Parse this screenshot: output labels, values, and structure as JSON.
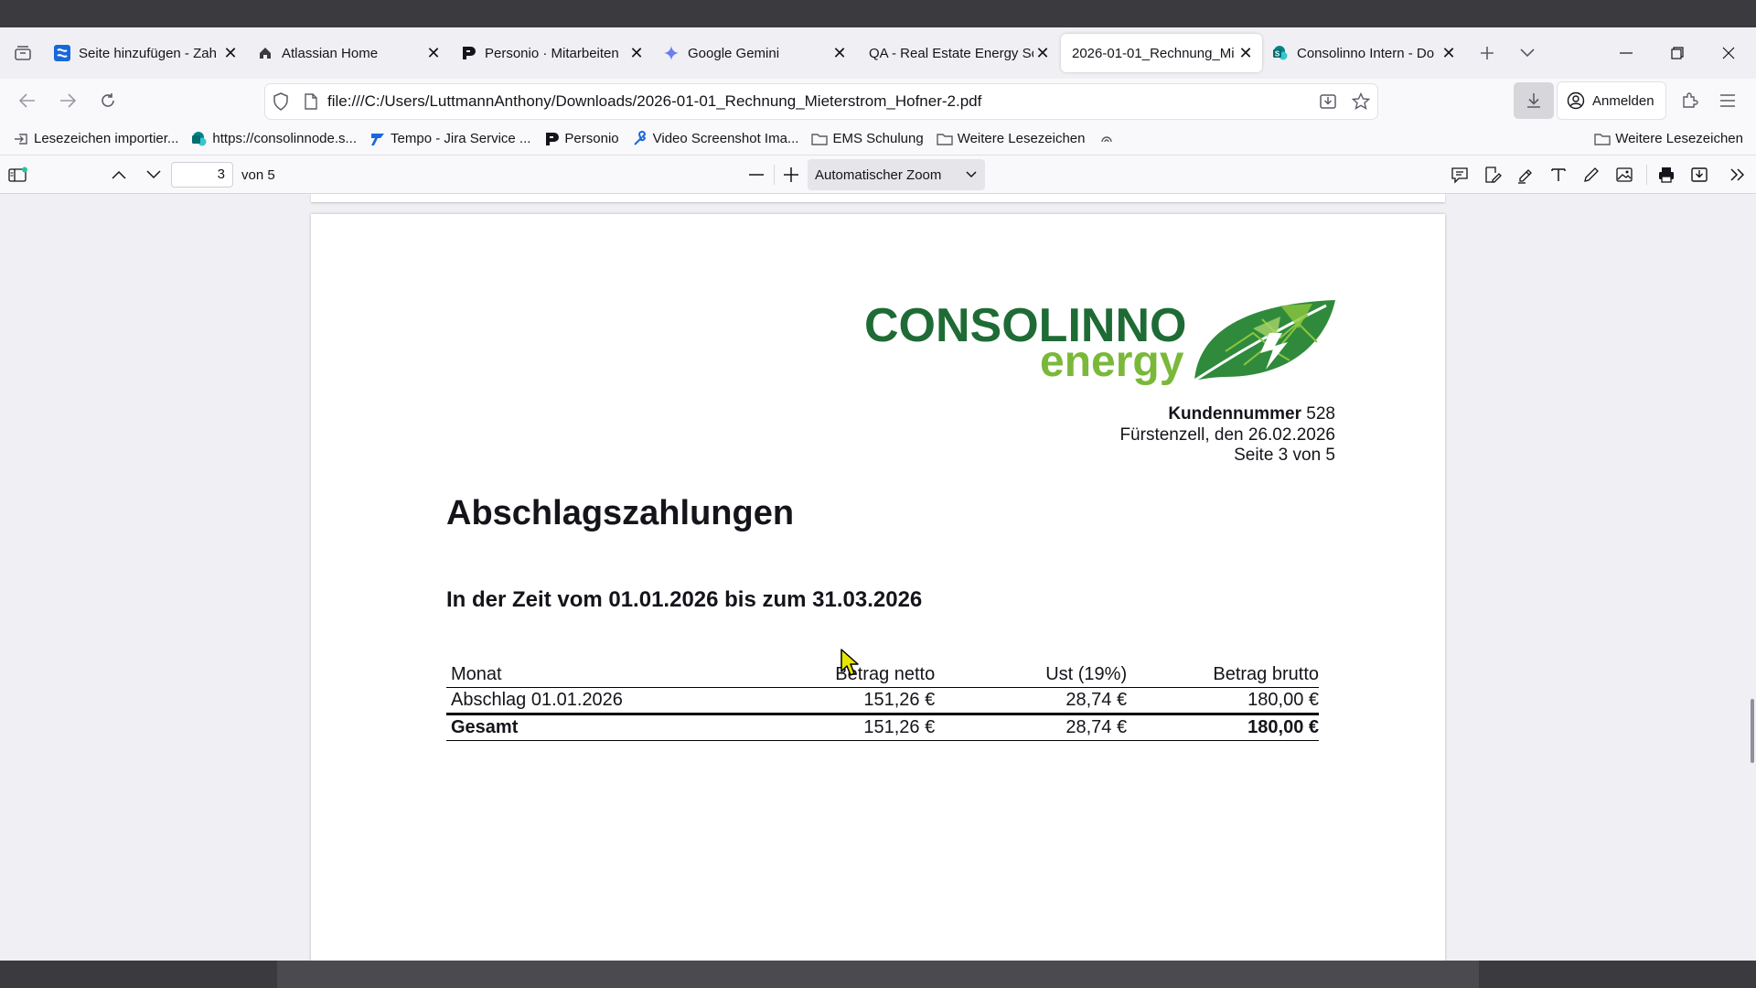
{
  "tabs": [
    {
      "title": "Seite hinzufügen - Zah",
      "icon": "confluence-icon",
      "active": false
    },
    {
      "title": "Atlassian Home",
      "icon": "home-icon",
      "active": false
    },
    {
      "title": "Personio · Mitarbeiten",
      "icon": "personio-icon",
      "active": false
    },
    {
      "title": "Google Gemini",
      "icon": "gemini-icon",
      "active": false
    },
    {
      "title": "QA - Real Estate Energy So",
      "icon": "none",
      "active": false
    },
    {
      "title": "2026-01-01_Rechnung_Mi",
      "icon": "none",
      "active": true
    },
    {
      "title": "Consolinno Intern - Do",
      "icon": "sharepoint-icon",
      "active": false
    }
  ],
  "urlbar": {
    "url": "file:///C:/Users/LuttmannAnthony/Downloads/2026-01-01_Rechnung_Mieterstrom_Hofner-2.pdf"
  },
  "account": {
    "signin_label": "Anmelden"
  },
  "bookmarks": [
    {
      "label": "Lesezeichen importier...",
      "icon": "import-icon"
    },
    {
      "label": "https://consolinnode.s...",
      "icon": "sharepoint-icon"
    },
    {
      "label": "Tempo - Jira Service ...",
      "icon": "tempo-icon"
    },
    {
      "label": "Personio",
      "icon": "personio-icon"
    },
    {
      "label": "Video Screenshot Ima...",
      "icon": "tools-icon"
    },
    {
      "label": "EMS Schulung",
      "icon": "folder-icon"
    },
    {
      "label": "Weitere Lesezeichen",
      "icon": "folder-icon"
    }
  ],
  "bookmarks_right": {
    "label": "Weitere Lesezeichen",
    "icon": "folder-icon"
  },
  "pdf_toolbar": {
    "page_number": "3",
    "page_count": "von 5",
    "zoom": "Automatischer Zoom"
  },
  "document": {
    "logo": {
      "word1": "CONSOLINNO",
      "word2": "energy",
      "primary_color": "#1f6b35",
      "secondary_color": "#7ab83a"
    },
    "customer_label": "Kundennummer",
    "customer_number": "528",
    "place_date": "Fürstenzell, den 26.02.2026",
    "page_info": "Seite 3 von 5",
    "title": "Abschlagszahlungen",
    "period": "In der Zeit vom 01.01.2026 bis zum 31.03.2026",
    "table": {
      "headers": [
        "Monat",
        "Betrag netto",
        "Ust (19%)",
        "Betrag brutto"
      ],
      "rows": [
        [
          "Abschlag 01.01.2026",
          "151,26 €",
          "28,74 €",
          "180,00 €"
        ]
      ],
      "total": [
        "Gesamt",
        "151,26 €",
        "28,74 €",
        "180,00 €"
      ]
    }
  }
}
